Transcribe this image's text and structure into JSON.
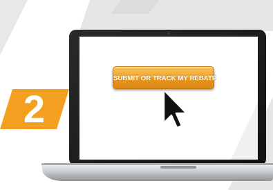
{
  "step": {
    "number": "2"
  },
  "cta": {
    "label": "SUBMIT OR TRACK MY REBATE"
  },
  "colors": {
    "accent_orange": "#f3a020",
    "button_orange": "#f0a52e",
    "stripe_gray": "#e6e6e6",
    "laptop_bezel": "#1c1c1c",
    "laptop_base": "#cfd2d5"
  },
  "icons": {
    "cursor": "arrow-pointer-icon",
    "camera": "webcam-icon"
  }
}
